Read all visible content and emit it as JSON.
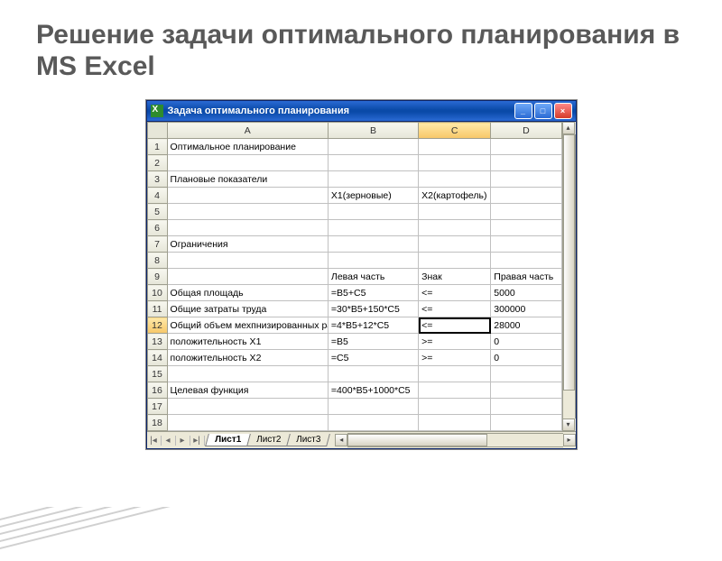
{
  "slide": {
    "title": "Решение задачи оптимального планирования в MS Excel"
  },
  "window": {
    "title": "Задача оптимального планирования"
  },
  "columns": [
    "A",
    "B",
    "C",
    "D"
  ],
  "rows": [
    {
      "n": "1",
      "A": "Оптимальное планирование",
      "B": "",
      "C": "",
      "D": ""
    },
    {
      "n": "2",
      "A": "",
      "B": "",
      "C": "",
      "D": ""
    },
    {
      "n": "3",
      "A": "Плановые показатели",
      "B": "",
      "C": "",
      "D": ""
    },
    {
      "n": "4",
      "A": "",
      "B": "X1(зерновые)",
      "C": "X2(картофель)",
      "D": ""
    },
    {
      "n": "5",
      "A": "",
      "B": "",
      "C": "",
      "D": ""
    },
    {
      "n": "6",
      "A": "",
      "B": "",
      "C": "",
      "D": ""
    },
    {
      "n": "7",
      "A": "Ограничения",
      "B": "",
      "C": "",
      "D": ""
    },
    {
      "n": "8",
      "A": "",
      "B": "",
      "C": "",
      "D": ""
    },
    {
      "n": "9",
      "A": "",
      "B": "Левая часть",
      "C": "Знак",
      "D": "Правая часть"
    },
    {
      "n": "10",
      "A": "Общая площадь",
      "B": "=B5+C5",
      "C": "<=",
      "D": "5000"
    },
    {
      "n": "11",
      "A": "Общие затраты труда",
      "B": "=30*B5+150*C5",
      "C": "<=",
      "D": "300000"
    },
    {
      "n": "12",
      "A": "Общий объем мехпнизированных работ",
      "B": "=4*B5+12*C5",
      "C": "<=",
      "D": "28000"
    },
    {
      "n": "13",
      "A": "положительность X1",
      "B": "=B5",
      "C": ">=",
      "D": "0"
    },
    {
      "n": "14",
      "A": "положительность X2",
      "B": "=C5",
      "C": ">=",
      "D": "0"
    },
    {
      "n": "15",
      "A": "",
      "B": "",
      "C": "",
      "D": ""
    },
    {
      "n": "16",
      "A": "Целевая функция",
      "B": "=400*B5+1000*C5",
      "C": "",
      "D": ""
    },
    {
      "n": "17",
      "A": "",
      "B": "",
      "C": "",
      "D": ""
    },
    {
      "n": "18",
      "A": "",
      "B": "",
      "C": "",
      "D": ""
    }
  ],
  "selection": {
    "row": 12,
    "col": "C"
  },
  "tabs": {
    "active": "Лист1",
    "others": [
      "Лист2",
      "Лист3"
    ]
  }
}
